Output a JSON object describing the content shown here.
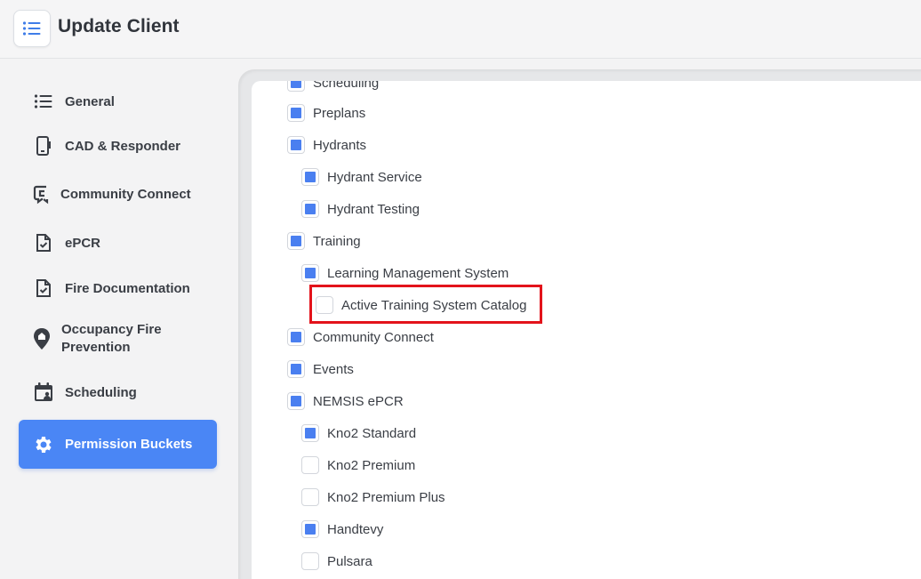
{
  "header": {
    "title": "Update Client",
    "menu_icon": "list-icon"
  },
  "sidebar": {
    "items": [
      {
        "label": "General",
        "icon": "list-icon",
        "active": false
      },
      {
        "label": "CAD & Responder",
        "icon": "mobile-icon",
        "active": false
      },
      {
        "label": "Community Connect",
        "icon": "community-connect-icon",
        "active": false
      },
      {
        "label": "ePCR",
        "icon": "document-check-icon",
        "active": false
      },
      {
        "label": "Fire Documentation",
        "icon": "document-check-icon",
        "active": false
      },
      {
        "label": "Occupancy Fire Prevention",
        "icon": "map-pin-icon",
        "active": false
      },
      {
        "label": "Scheduling",
        "icon": "calendar-user-icon",
        "active": false
      },
      {
        "label": "Permission Buckets",
        "icon": "gear-icon",
        "active": true
      }
    ]
  },
  "permissions": [
    {
      "label": "Scheduling",
      "checked": true,
      "level": 0
    },
    {
      "label": "Preplans",
      "checked": true,
      "level": 0
    },
    {
      "label": "Hydrants",
      "checked": true,
      "level": 0
    },
    {
      "label": "Hydrant Service",
      "checked": true,
      "level": 1
    },
    {
      "label": "Hydrant Testing",
      "checked": true,
      "level": 1
    },
    {
      "label": "Training",
      "checked": true,
      "level": 0
    },
    {
      "label": "Learning Management System",
      "checked": true,
      "level": 1
    },
    {
      "label": "Active Training System Catalog",
      "checked": false,
      "level": 2
    },
    {
      "label": "Community Connect",
      "checked": true,
      "level": 0
    },
    {
      "label": "Events",
      "checked": true,
      "level": 0
    },
    {
      "label": "NEMSIS ePCR",
      "checked": true,
      "level": 0
    },
    {
      "label": "Kno2 Standard",
      "checked": true,
      "level": 1
    },
    {
      "label": "Kno2 Premium",
      "checked": false,
      "level": 1
    },
    {
      "label": "Kno2 Premium Plus",
      "checked": false,
      "level": 1
    },
    {
      "label": "Handtevy",
      "checked": true,
      "level": 1
    },
    {
      "label": "Pulsara",
      "checked": false,
      "level": 1
    }
  ],
  "colors": {
    "accent": "#4a86f5",
    "checkbox_fill": "#4a7ff0",
    "highlight": "#e3131b"
  }
}
